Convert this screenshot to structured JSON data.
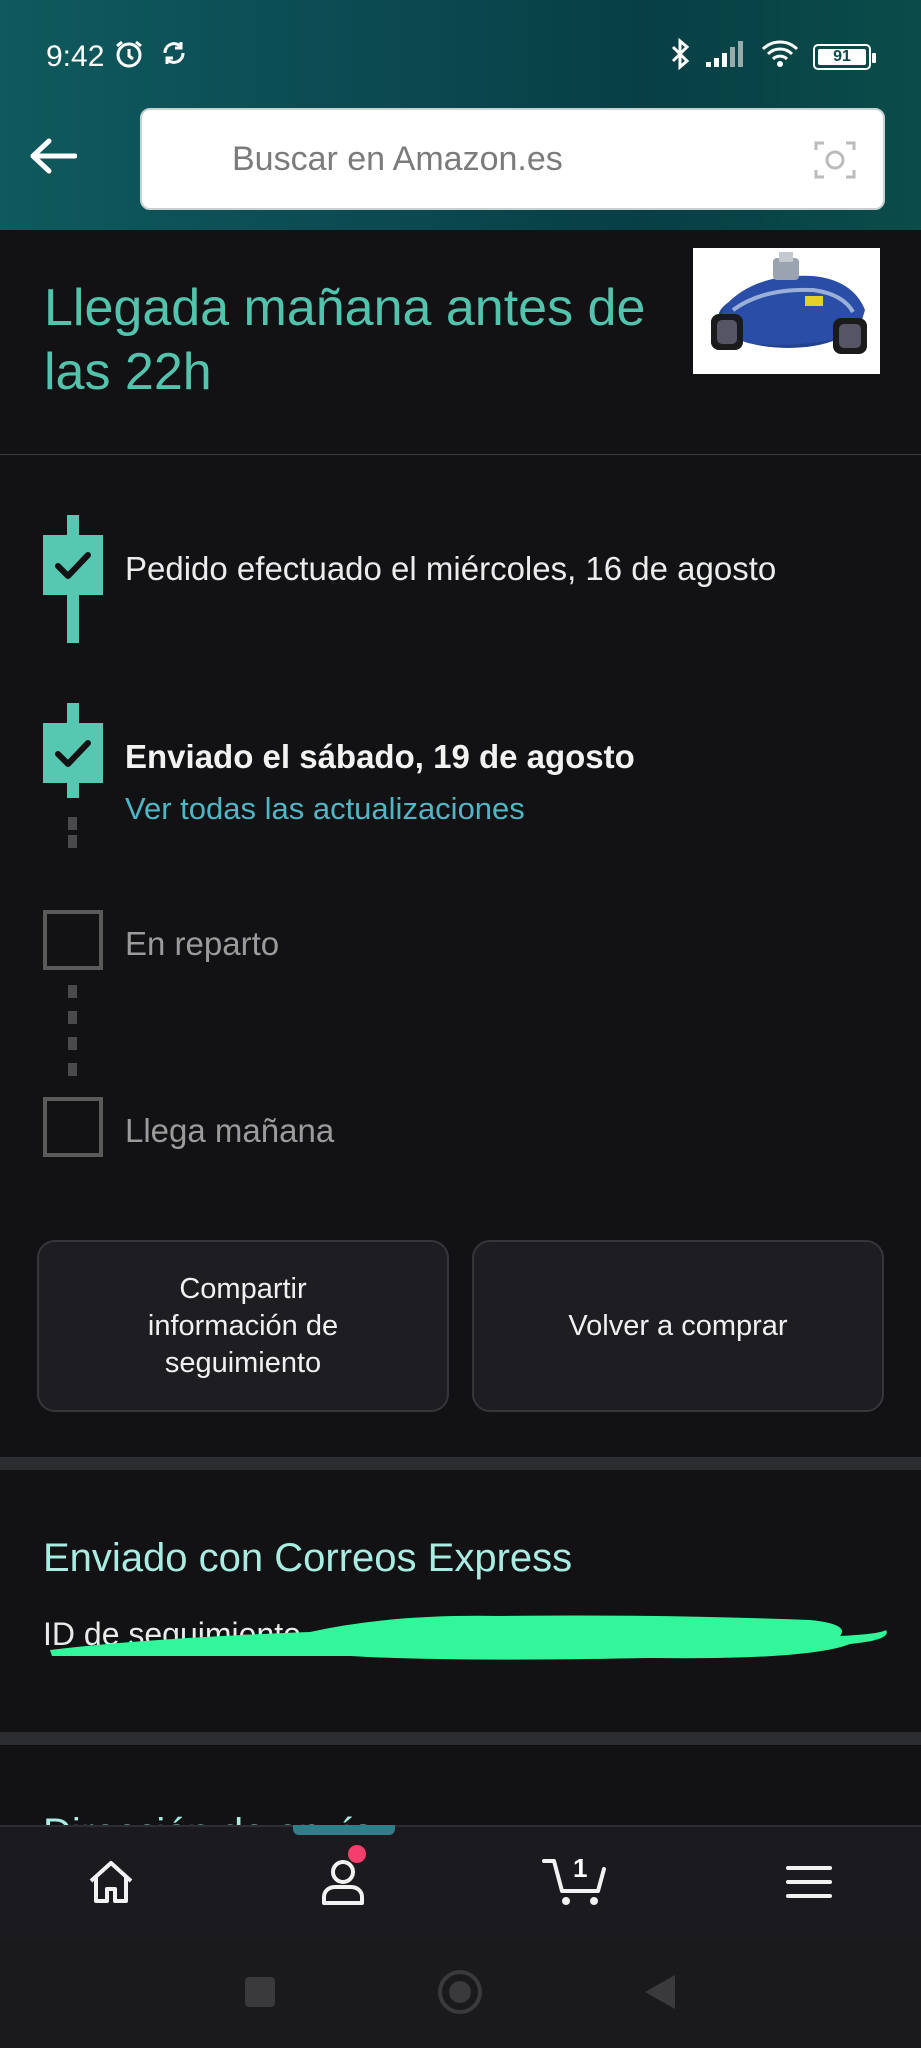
{
  "status_bar": {
    "time": "9:42",
    "battery": "91"
  },
  "search": {
    "placeholder": "Buscar en Amazon.es"
  },
  "arrival": {
    "title": "Llegada mañana antes de las 22h"
  },
  "timeline": {
    "steps": [
      {
        "label": "Pedido efectuado el miércoles, 16 de agosto",
        "done": true
      },
      {
        "label": "Enviado el sábado, 19 de agosto",
        "done": true,
        "link": "Ver todas las actualizaciones"
      },
      {
        "label": "En reparto",
        "done": false
      },
      {
        "label": "Llega mañana",
        "done": false
      }
    ]
  },
  "actions": {
    "share_label": "Compartir información de seguimiento",
    "buy_again_label": "Volver a comprar"
  },
  "shipping": {
    "carrier_title": "Enviado con Correos Express",
    "tracking_label": "ID de seguimiento"
  },
  "next_section": {
    "title": "Dirección de envío"
  },
  "bottom_nav": {
    "cart_count": "1",
    "items": [
      "home-icon",
      "account-icon",
      "cart-icon",
      "menu-icon"
    ]
  },
  "colors": {
    "accent_teal": "#56c7b0",
    "link": "#4fb6c6",
    "header": "#0c4a52",
    "redaction": "#33f59a"
  }
}
